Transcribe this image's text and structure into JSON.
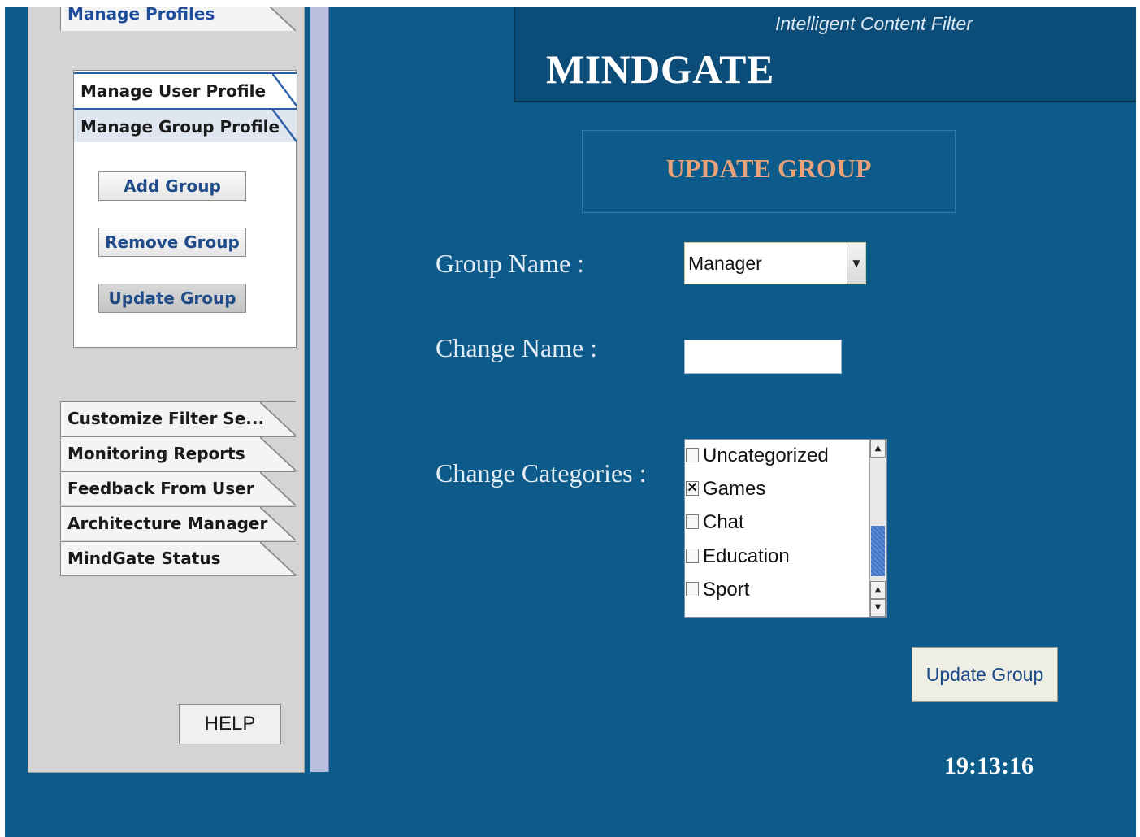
{
  "sidebar": {
    "manage_profiles_tab": "Manage Profiles",
    "subtabs": [
      "Manage User Profile",
      "Manage Group Profile"
    ],
    "group_buttons": {
      "add": "Add Group",
      "remove": "Remove Group",
      "update": "Update Group"
    },
    "tabs": [
      "Customize Filter Se...",
      "Monitoring Reports",
      "Feedback From User",
      "Architecture Manager",
      "MindGate Status"
    ],
    "help_label": "HELP"
  },
  "header": {
    "title": "MINDGATE",
    "tagline": "Intelligent Content Filter"
  },
  "main": {
    "heading": "UPDATE GROUP",
    "form": {
      "group_name_label": "Group Name :",
      "group_name_value": "Manager",
      "change_name_label": "Change Name :",
      "change_name_value": "",
      "categories_label": "Change Categories :",
      "categories": [
        {
          "name": "Uncategorized",
          "checked": false
        },
        {
          "name": "Games",
          "checked": true
        },
        {
          "name": "Chat",
          "checked": false
        },
        {
          "name": "Education",
          "checked": false
        },
        {
          "name": "Sport",
          "checked": false
        }
      ]
    },
    "submit_label": "Update Group",
    "clock": "19:13:16"
  },
  "colors": {
    "background": "#0d5b8a",
    "header": "#0b4c78",
    "heading_text": "#e8a27a",
    "sidebar": "#d4d4d4"
  }
}
